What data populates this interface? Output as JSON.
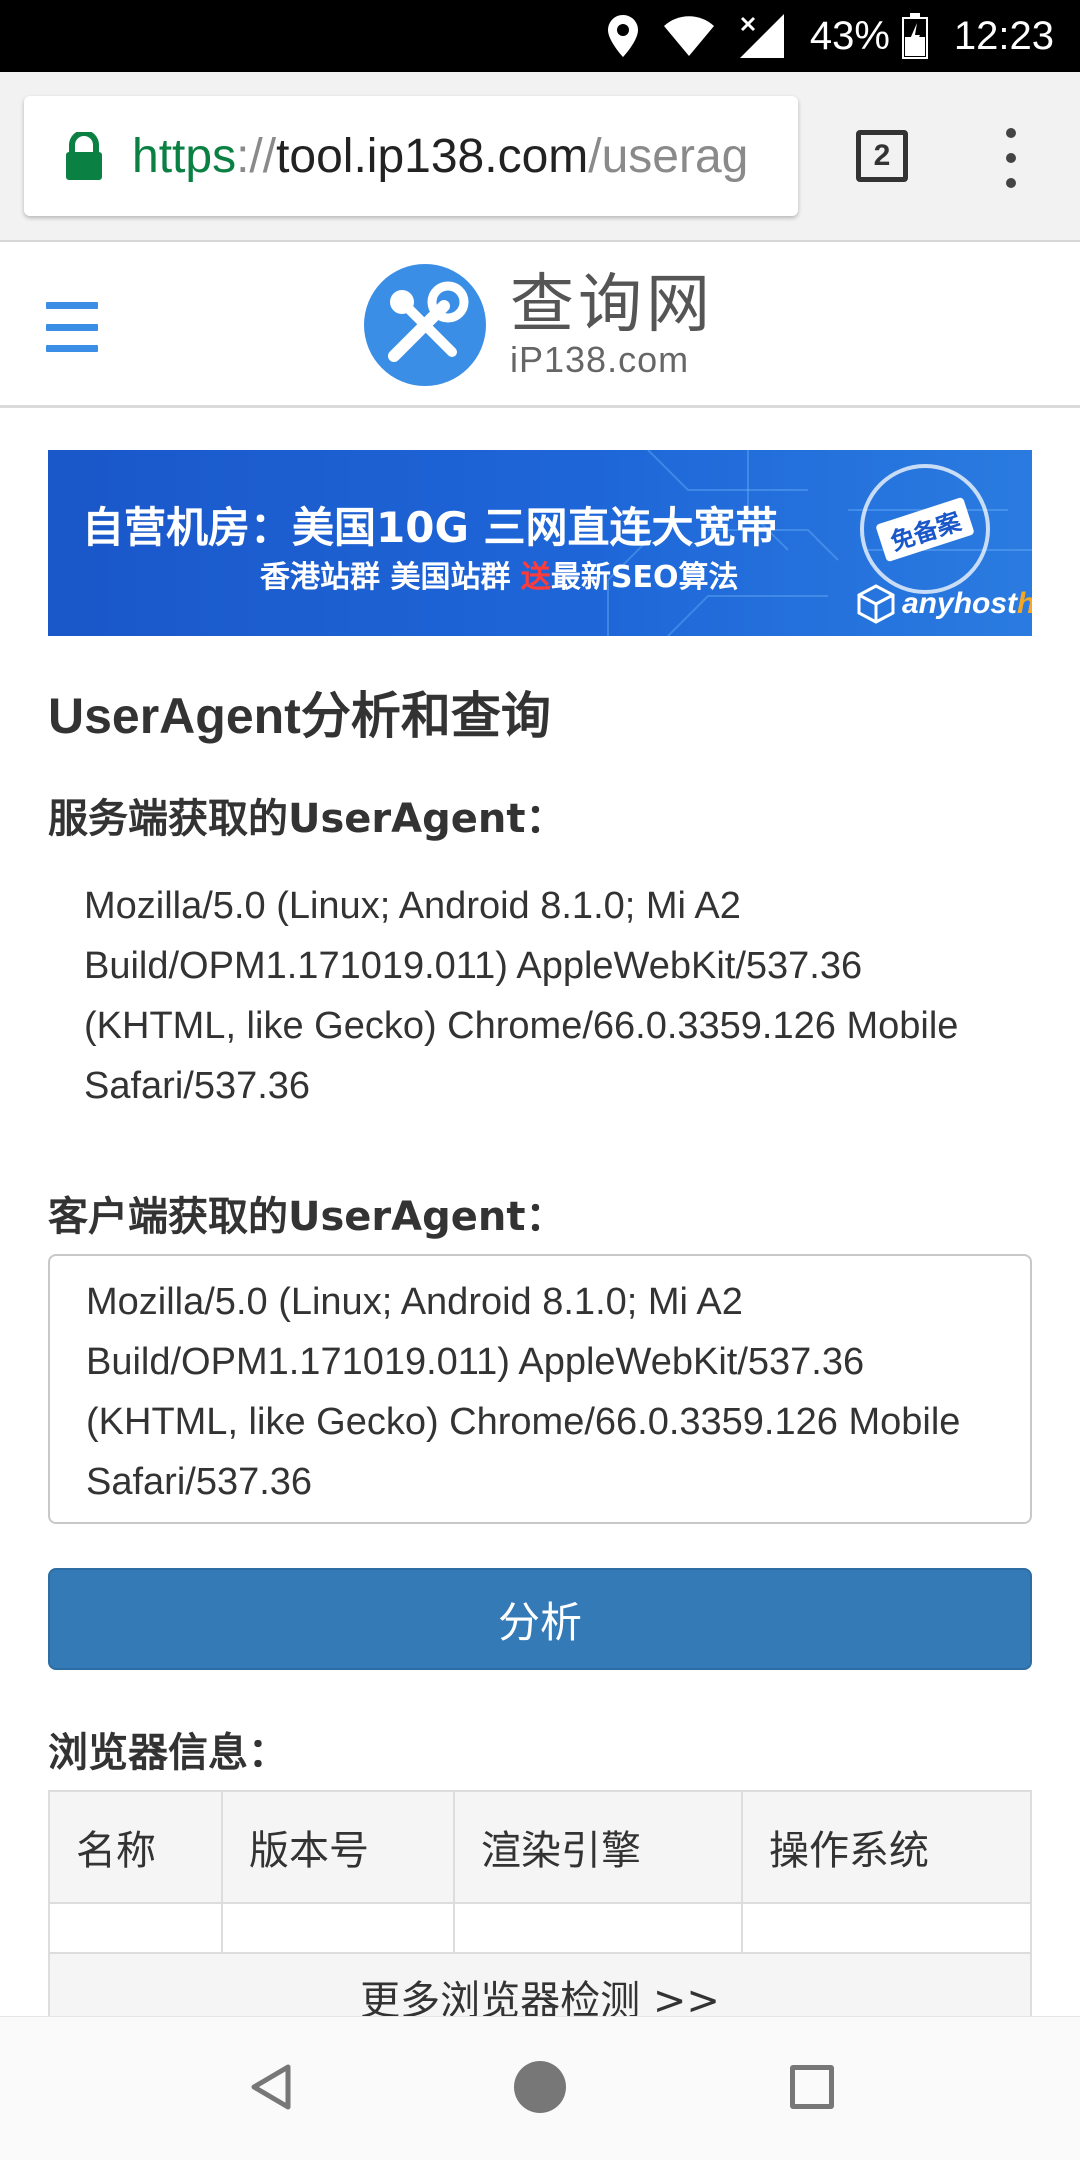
{
  "status_bar": {
    "battery": "43%",
    "time": "12:23",
    "icons": [
      "location-icon",
      "wifi-icon",
      "signal-icon",
      "battery-icon"
    ]
  },
  "browser": {
    "url_scheme": "https",
    "url_separator": "://",
    "url_host": "tool.ip138.com",
    "url_path": "/userag",
    "tab_count": "2",
    "accent_secure": "#0b8043"
  },
  "site": {
    "logo_title": "查询网",
    "logo_subtitle": "iP138.com",
    "brand_color": "#3a8ee6"
  },
  "banner": {
    "line1": "自营机房：美国10G 三网直连大宽带",
    "line2_a": "香港站群 美国站群 ",
    "line2_highlight": "送",
    "line2_b": "最新SEO算法",
    "seal": "免备案",
    "brand_a": "anyhost",
    "brand_b": "hub"
  },
  "main": {
    "title": "UserAgent分析和查询",
    "server_label": "服务端获取的UserAgent：",
    "server_ua": "Mozilla/5.0 (Linux; Android 8.1.0; Mi A2 Build/OPM1.171019.011) AppleWebKit/537.36 (KHTML, like Gecko) Chrome/66.0.3359.126 Mobile Safari/537.36",
    "client_label": "客户端获取的UserAgent：",
    "client_ua": "Mozilla/5.0 (Linux; Android 8.1.0; Mi A2 Build/OPM1.171019.011) AppleWebKit/537.36 (KHTML, like Gecko) Chrome/66.0.3359.126 Mobile Safari/537.36",
    "analyze_button": "分析",
    "button_color": "#337ab7",
    "browser_info_label": "浏览器信息：",
    "table": {
      "headers": [
        "名称",
        "版本号",
        "渲染引擎",
        "操作系统"
      ],
      "more_link": "更多浏览器检测 >>"
    }
  },
  "nav": {
    "icons": [
      "back-icon",
      "home-icon",
      "recents-icon"
    ]
  }
}
